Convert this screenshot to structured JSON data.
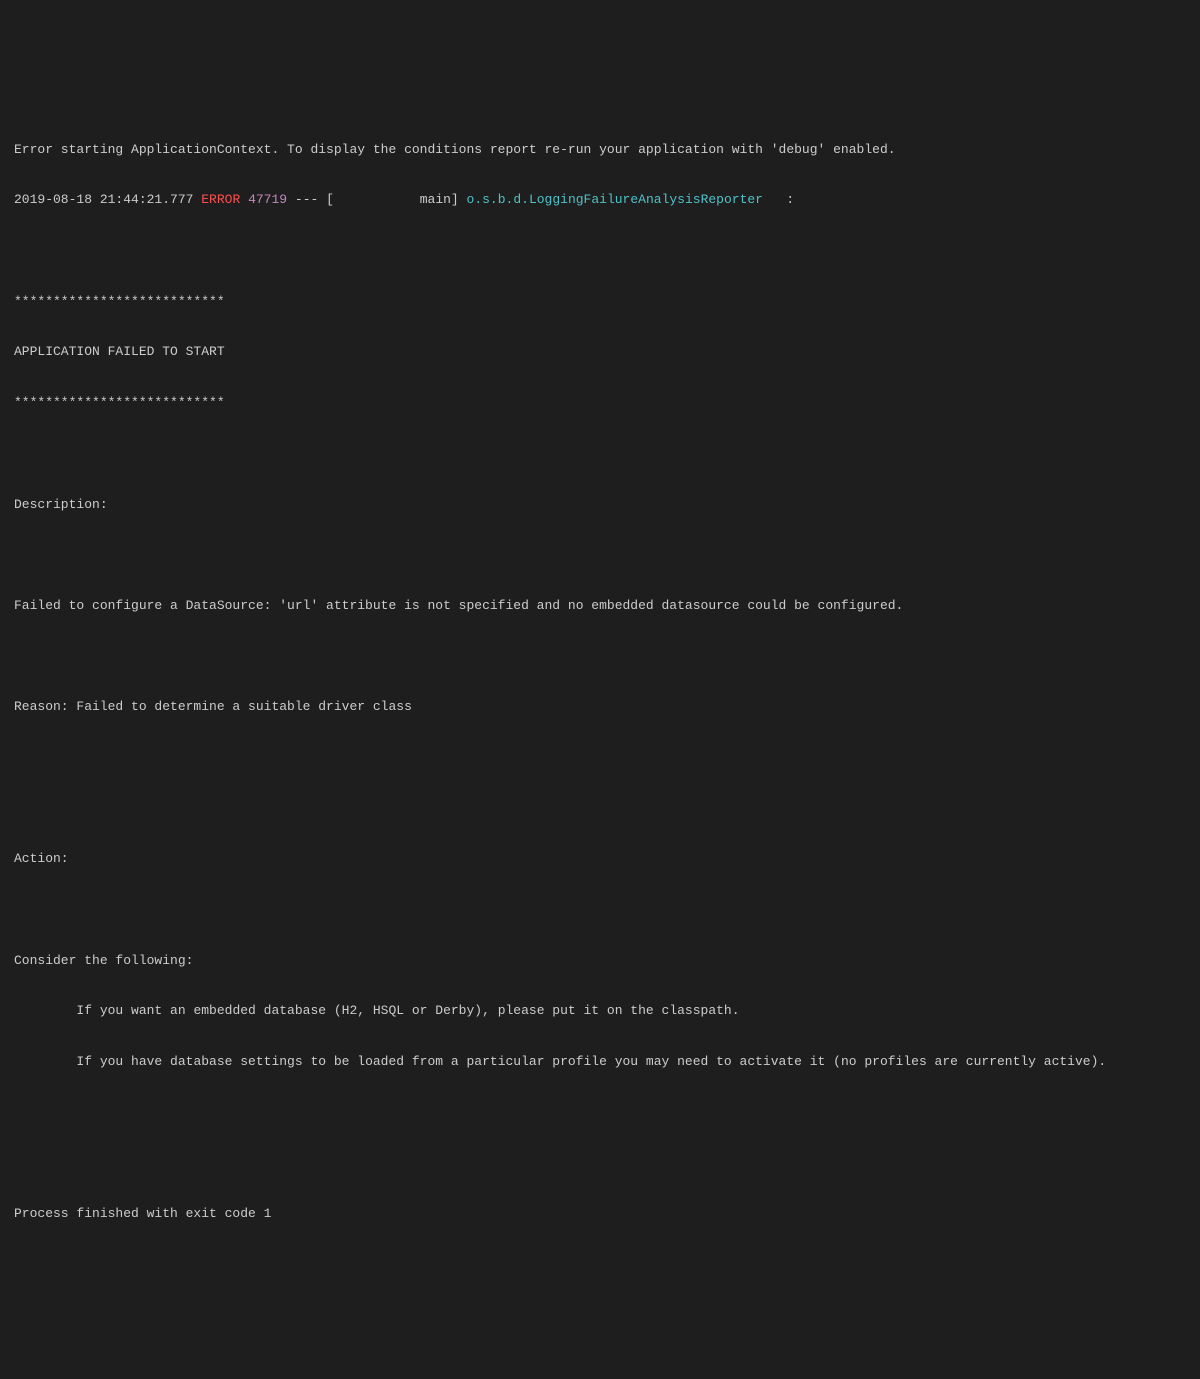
{
  "console": {
    "context_line": "Error starting ApplicationContext. To display the conditions report re-run your application with 'debug' enabled.",
    "log": {
      "timestamp": "2019-08-18 21:44:21.777",
      "level": "ERROR",
      "pid": "47719",
      "separator": " --- [           main] ",
      "logger": "o.s.b.d.LoggingFailureAnalysisReporter",
      "tail": "   :"
    },
    "banner_border": "***************************",
    "banner_title": "APPLICATION FAILED TO START",
    "description_label": "Description:",
    "description_text": "Failed to configure a DataSource: 'url' attribute is not specified and no embedded datasource could be configured.",
    "reason_text": "Reason: Failed to determine a suitable driver class",
    "action_label": "Action:",
    "action_intro": "Consider the following:",
    "action_item1": "\tIf you want an embedded database (H2, HSQL or Derby), please put it on the classpath.",
    "action_item2": "\tIf you have database settings to be loaded from a particular profile you may need to activate it (no profiles are currently active).",
    "exit_line": "Process finished with exit code 1"
  }
}
